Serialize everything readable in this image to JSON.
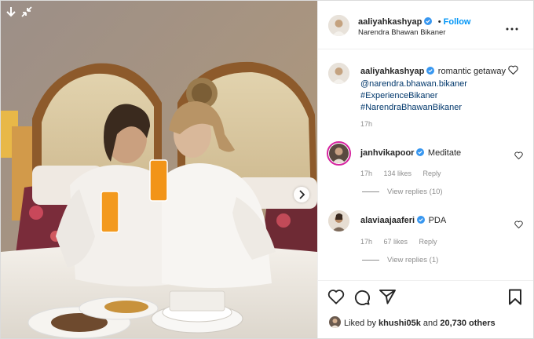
{
  "post": {
    "author": "aaliyahkashyap",
    "follow_label": "Follow",
    "follow_separator": "•",
    "location": "Narendra Bhawan Bikaner",
    "caption_text": "romantic getaway",
    "caption_tags": [
      "@narendra.bhawan.bikaner",
      "#ExperienceBikaner",
      "#NarendraBhawanBikaner"
    ],
    "caption_time": "17h",
    "more_icon": "more-horizontal-icon"
  },
  "comments": [
    {
      "user": "janhvikapoor",
      "text": "Meditate",
      "time": "17h",
      "likes": "134 likes",
      "reply_label": "Reply",
      "view_replies": "View replies (10)"
    },
    {
      "user": "alaviaajaaferi",
      "text": "PDA",
      "time": "17h",
      "likes": "67 likes",
      "reply_label": "Reply",
      "view_replies": "View replies (1)"
    }
  ],
  "footer": {
    "liked_by_prefix": "Liked by",
    "liked_by_user": "khushi05k",
    "liked_by_and": "and",
    "liked_by_others": "20,730 others",
    "icons": [
      "heart-icon",
      "comment-icon",
      "share-icon",
      "bookmark-icon"
    ]
  },
  "colors": {
    "link": "#0095f6",
    "hashtag": "#00376b",
    "muted": "#8e8e8e",
    "text": "#262626",
    "verified": "#3897f0"
  }
}
